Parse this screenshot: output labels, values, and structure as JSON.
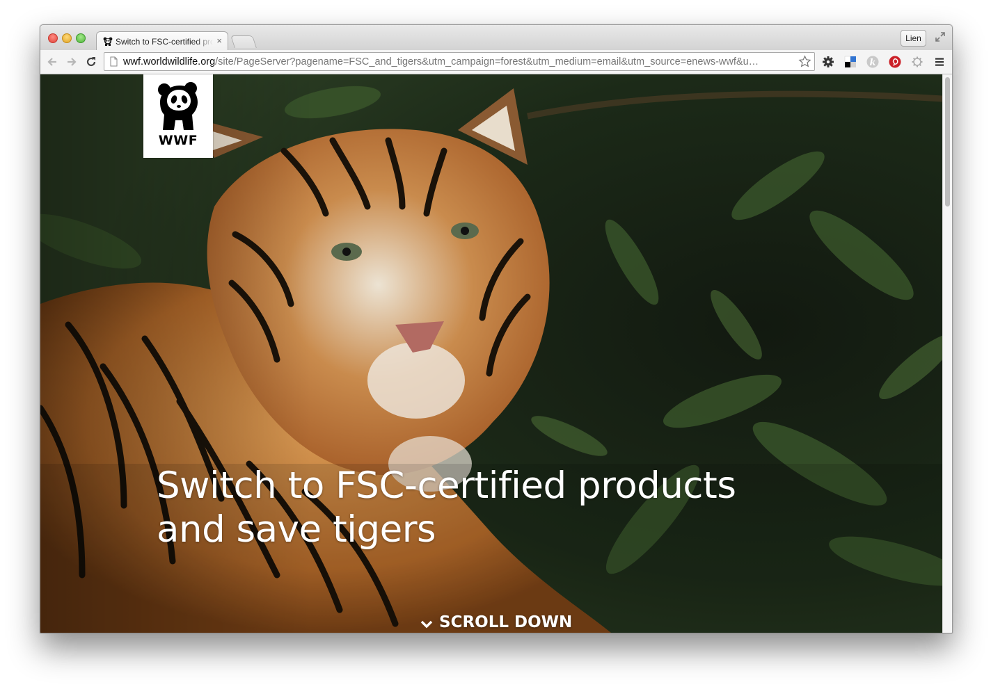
{
  "browser": {
    "tab": {
      "title": "Switch to FSC-certified products and save tigers",
      "close_glyph": "×"
    },
    "profile_button": "Lien",
    "url": {
      "host": "wwf.worldwildlife.org",
      "path": "/site/PageServer?pagename=FSC_and_tigers&utm_campaign=forest&utm_medium=email&utm_source=enews-wwf&u…"
    },
    "icons": {
      "back": "back-arrow-icon",
      "forward": "forward-arrow-icon",
      "reload": "reload-icon",
      "page": "page-icon",
      "bookmark": "star-icon",
      "extensions": [
        "gear-icon",
        "delicious-icon",
        "k-extension-icon",
        "pinterest-icon",
        "settings-extension-icon",
        "menu-icon"
      ]
    },
    "colors": {
      "pinterest": "#cb2027",
      "traffic_red": "#ff5f57",
      "traffic_yellow": "#ffbd2e",
      "traffic_green": "#28c940"
    }
  },
  "page": {
    "logo_text": "WWF",
    "headline": "Switch to FSC-certified products and save tigers",
    "scroll_down": "SCROLL DOWN"
  }
}
